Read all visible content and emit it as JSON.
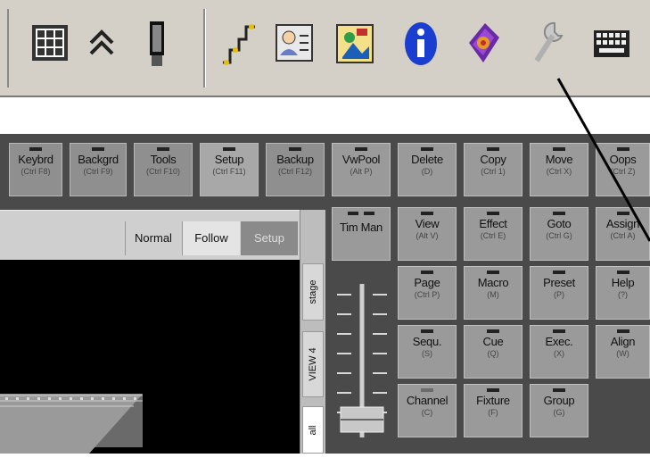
{
  "toolbar": {
    "icons": [
      "window-grid-icon",
      "collapse-up-icon",
      "phone-device-icon",
      "graph-step-icon",
      "user-card-icon",
      "image-paint-icon",
      "info-icon",
      "book-gem-icon",
      "wrench-icon",
      "keyboard-icon"
    ]
  },
  "fkeys": [
    {
      "label": "Keybrd",
      "sub": "(Ctrl F8)"
    },
    {
      "label": "Backgrd",
      "sub": "(Ctrl F9)"
    },
    {
      "label": "Tools",
      "sub": "(Ctrl F10)"
    },
    {
      "label": "Setup",
      "sub": "(Ctrl F11)"
    },
    {
      "label": "Backup",
      "sub": "(Ctrl F12)"
    }
  ],
  "keys": {
    "vwpool": {
      "label": "VwPool",
      "sub": "(Alt P)"
    },
    "delete": {
      "label": "Delete",
      "sub": "(D)"
    },
    "copy": {
      "label": "Copy",
      "sub": "(Ctrl 1)"
    },
    "move": {
      "label": "Move",
      "sub": "(Ctrl X)"
    },
    "oops": {
      "label": "Oops",
      "sub": "(Ctrl Z)"
    },
    "timman": {
      "label": "Tim Man",
      "sub": ""
    },
    "view": {
      "label": "View",
      "sub": "(Alt V)"
    },
    "effect": {
      "label": "Effect",
      "sub": "(Ctrl E)"
    },
    "goto": {
      "label": "Goto",
      "sub": "(Ctrl G)"
    },
    "assign": {
      "label": "Assign",
      "sub": "(Ctrl A)"
    },
    "page": {
      "label": "Page",
      "sub": "(Ctrl P)"
    },
    "macro": {
      "label": "Macro",
      "sub": "(M)"
    },
    "preset": {
      "label": "Preset",
      "sub": "(P)"
    },
    "help": {
      "label": "Help",
      "sub": "(?)"
    },
    "sequ": {
      "label": "Sequ.",
      "sub": "(S)"
    },
    "cue": {
      "label": "Cue",
      "sub": "(Q)"
    },
    "exec": {
      "label": "Exec.",
      "sub": "(X)"
    },
    "align": {
      "label": "Align",
      "sub": "(W)"
    },
    "channel": {
      "label": "Channel",
      "sub": "(C)"
    },
    "fixture": {
      "label": "Fixture",
      "sub": "(F)"
    },
    "group": {
      "label": "Group",
      "sub": "(G)"
    }
  },
  "view_tabs": {
    "normal": "Normal",
    "follow": "Follow",
    "setup": "Setup"
  },
  "side_tabs": {
    "stage": "stage",
    "view4": "VIEW 4",
    "all": "all"
  },
  "colors": {
    "toolbar_bg": "#d4d0c8",
    "key_bg": "#9a9a9a",
    "panel_bg": "#4a4a4a"
  }
}
